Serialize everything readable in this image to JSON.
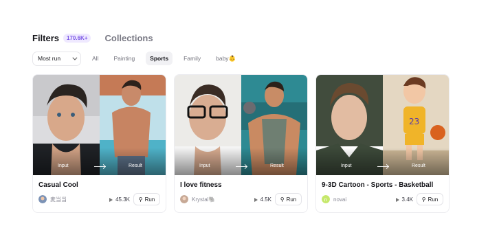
{
  "header": {
    "tab_filters": "Filters",
    "filters_count": "170.6K+",
    "tab_collections": "Collections"
  },
  "filters": {
    "sort_selected": "Most run",
    "categories": [
      "All",
      "Painting",
      "Sports",
      "Family",
      "baby👶"
    ],
    "active_category": "Sports"
  },
  "cards": [
    {
      "title": "Casual Cool",
      "author": "麦当当",
      "runs": "45.3K",
      "run_label": "Run",
      "input_label": "Input",
      "result_label": "Result",
      "accent_left": "#d8d8dc",
      "accent_right": "#4fb2c8"
    },
    {
      "title": "I love fitness",
      "author": "Krystal🐘",
      "runs": "4.5K",
      "run_label": "Run",
      "input_label": "Input",
      "result_label": "Result",
      "accent_left": "#e9e7e3",
      "accent_right": "#2e8a93"
    },
    {
      "title": "9-3D Cartoon - Sports - Basketball",
      "author": "novai",
      "runs": "3.4K",
      "run_label": "Run",
      "input_label": "Input",
      "result_label": "Result",
      "accent_left": "#3d4a3a",
      "accent_right": "#d9cbb6"
    }
  ],
  "icons": {
    "sort_dropdown": "chevron-down-icon",
    "runs": "play-icon",
    "run_button": "magic-wand-icon"
  }
}
